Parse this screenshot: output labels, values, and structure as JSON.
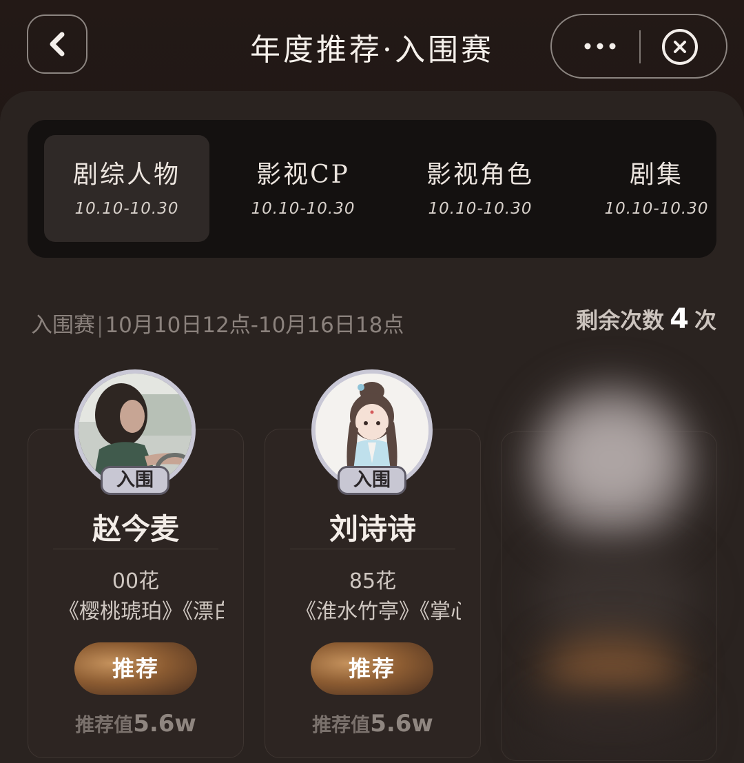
{
  "header": {
    "title": "年度推荐·入围赛",
    "back_icon": "chevron-left-icon",
    "more_icon": "more-dots-icon",
    "close_icon": "close-circle-icon"
  },
  "tabs": [
    {
      "label": "剧综人物",
      "date": "10.10-10.30",
      "active": true
    },
    {
      "label": "影视CP",
      "date": "10.10-10.30",
      "active": false
    },
    {
      "label": "影视角色",
      "date": "10.10-10.30",
      "active": false
    },
    {
      "label": "剧集",
      "date": "10.10-10.30",
      "active": false
    }
  ],
  "phase": {
    "name": "入围赛",
    "separator": "|",
    "time": "10月10日12点-10月16日18点"
  },
  "remaining": {
    "label": "剩余次数",
    "count": "4",
    "unit": "次"
  },
  "candidates": [
    {
      "name": "赵今麦",
      "badge": "入围",
      "tag": "00花",
      "works": "《樱桃琥珀》《漂白",
      "button": "推荐",
      "value_label": "推荐值",
      "value": "5.6w"
    },
    {
      "name": "刘诗诗",
      "badge": "入围",
      "tag": "85花",
      "works": "《淮水竹亭》《掌心",
      "button": "推荐",
      "value_label": "推荐值",
      "value": "5.6w"
    }
  ],
  "colors": {
    "background": "#1f1714",
    "panel": "#2a2320",
    "button_gold": "#a9743f",
    "badge": "#c8c7d3"
  }
}
